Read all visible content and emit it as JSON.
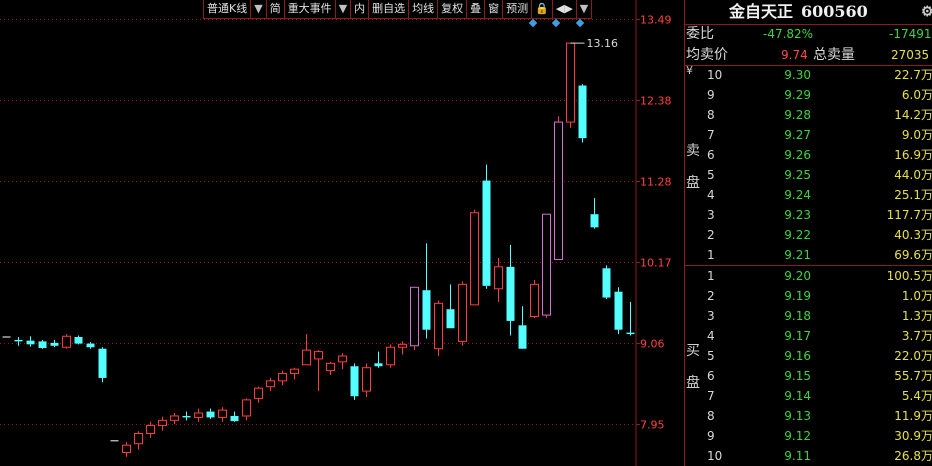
{
  "toolbar": {
    "items": [
      "普通K线",
      "▼",
      "简",
      "重大事件",
      "▼",
      "内",
      "删自选",
      "均线",
      "复权",
      "叠",
      "窗",
      "预测",
      "🔒",
      "◀▶",
      "▼"
    ]
  },
  "chart": {
    "annotation_high": "13.16",
    "axis_labels": [
      "13.49",
      "12.38",
      "11.28",
      "10.17",
      "9.06",
      "7.95"
    ],
    "colors": {
      "up": "#ff3c3c",
      "down": "#54ffff",
      "grid": "#8a1c1c",
      "axis_text": "#ff4040"
    }
  },
  "chart_data": {
    "type": "candlestick",
    "ylim": [
      7.6,
      13.6
    ],
    "ticks": [
      13.49,
      12.38,
      11.28,
      10.17,
      9.06,
      7.95
    ],
    "candles": [
      {
        "o": 9.14,
        "h": 9.14,
        "l": 9.14,
        "c": 9.14
      },
      {
        "o": 9.1,
        "h": 9.14,
        "l": 9.02,
        "c": 9.08
      },
      {
        "o": 9.09,
        "h": 9.15,
        "l": 9.01,
        "c": 9.04
      },
      {
        "o": 9.08,
        "h": 9.1,
        "l": 8.98,
        "c": 8.99
      },
      {
        "o": 9.06,
        "h": 9.1,
        "l": 9.0,
        "c": 9.02
      },
      {
        "o": 9.0,
        "h": 9.18,
        "l": 8.98,
        "c": 9.15
      },
      {
        "o": 9.14,
        "h": 9.16,
        "l": 9.04,
        "c": 9.05
      },
      {
        "o": 9.05,
        "h": 9.07,
        "l": 8.98,
        "c": 9.0
      },
      {
        "o": 8.98,
        "h": 9.0,
        "l": 8.52,
        "c": 8.58
      },
      {
        "o": 7.72,
        "h": 7.72,
        "l": 7.72,
        "c": 7.72
      },
      {
        "o": 7.56,
        "h": 7.7,
        "l": 7.5,
        "c": 7.66
      },
      {
        "o": 7.68,
        "h": 7.85,
        "l": 7.6,
        "c": 7.82
      },
      {
        "o": 7.82,
        "h": 7.98,
        "l": 7.76,
        "c": 7.93
      },
      {
        "o": 7.93,
        "h": 8.05,
        "l": 7.86,
        "c": 8.0
      },
      {
        "o": 8.0,
        "h": 8.1,
        "l": 7.95,
        "c": 8.06
      },
      {
        "o": 8.06,
        "h": 8.12,
        "l": 8.0,
        "c": 8.04
      },
      {
        "o": 8.04,
        "h": 8.16,
        "l": 7.98,
        "c": 8.1
      },
      {
        "o": 8.12,
        "h": 8.16,
        "l": 8.02,
        "c": 8.04
      },
      {
        "o": 8.04,
        "h": 8.18,
        "l": 7.98,
        "c": 8.14
      },
      {
        "o": 8.06,
        "h": 8.12,
        "l": 7.98,
        "c": 7.99
      },
      {
        "o": 8.06,
        "h": 8.3,
        "l": 8.0,
        "c": 8.28
      },
      {
        "o": 8.3,
        "h": 8.46,
        "l": 8.24,
        "c": 8.44
      },
      {
        "o": 8.46,
        "h": 8.58,
        "l": 8.4,
        "c": 8.54
      },
      {
        "o": 8.54,
        "h": 8.68,
        "l": 8.48,
        "c": 8.64
      },
      {
        "o": 8.64,
        "h": 8.72,
        "l": 8.56,
        "c": 8.7
      },
      {
        "o": 8.76,
        "h": 9.18,
        "l": 8.76,
        "c": 8.96
      },
      {
        "o": 8.84,
        "h": 8.96,
        "l": 8.4,
        "c": 8.94
      },
      {
        "o": 8.68,
        "h": 8.8,
        "l": 8.62,
        "c": 8.78
      },
      {
        "o": 8.8,
        "h": 8.92,
        "l": 8.7,
        "c": 8.88
      },
      {
        "o": 8.74,
        "h": 8.78,
        "l": 8.28,
        "c": 8.33
      },
      {
        "o": 8.4,
        "h": 8.78,
        "l": 8.32,
        "c": 8.72
      },
      {
        "o": 8.78,
        "h": 8.94,
        "l": 8.72,
        "c": 8.74
      },
      {
        "o": 8.76,
        "h": 9.04,
        "l": 8.72,
        "c": 9.0
      },
      {
        "o": 9.0,
        "h": 9.08,
        "l": 8.9,
        "c": 9.04
      },
      {
        "o": 9.02,
        "h": 9.82,
        "l": 8.96,
        "c": 9.82
      },
      {
        "o": 9.78,
        "h": 10.42,
        "l": 9.12,
        "c": 9.24
      },
      {
        "o": 8.98,
        "h": 9.64,
        "l": 8.88,
        "c": 9.6
      },
      {
        "o": 9.52,
        "h": 9.86,
        "l": 9.28,
        "c": 9.26
      },
      {
        "o": 9.08,
        "h": 9.9,
        "l": 9.02,
        "c": 9.86
      },
      {
        "o": 9.58,
        "h": 10.88,
        "l": 9.58,
        "c": 10.84
      },
      {
        "o": 11.28,
        "h": 11.5,
        "l": 9.8,
        "c": 9.84
      },
      {
        "o": 9.8,
        "h": 10.22,
        "l": 9.62,
        "c": 10.1
      },
      {
        "o": 10.1,
        "h": 10.4,
        "l": 9.16,
        "c": 9.36
      },
      {
        "o": 9.3,
        "h": 9.56,
        "l": 8.98,
        "c": 8.98
      },
      {
        "o": 9.42,
        "h": 9.92,
        "l": 9.4,
        "c": 9.86
      },
      {
        "o": 9.44,
        "h": 10.82,
        "l": 9.4,
        "c": 10.82
      },
      {
        "o": 10.2,
        "h": 12.16,
        "l": 10.2,
        "c": 12.08
      },
      {
        "o": 12.08,
        "h": 13.16,
        "l": 12.0,
        "c": 13.16
      },
      {
        "o": 12.58,
        "h": 12.6,
        "l": 11.8,
        "c": 11.86
      },
      {
        "o": 10.82,
        "h": 11.04,
        "l": 10.62,
        "c": 10.64
      },
      {
        "o": 10.08,
        "h": 10.12,
        "l": 9.66,
        "c": 9.68
      },
      {
        "o": 9.76,
        "h": 9.82,
        "l": 9.18,
        "c": 9.24
      },
      {
        "o": 9.2,
        "h": 9.62,
        "l": 9.16,
        "c": 9.18
      }
    ]
  },
  "book": {
    "stock_name": "金自天正",
    "stock_code": "600560",
    "gear_icon": "gear-icon",
    "weibi_label": "委比",
    "weibi_pct": "-47.82%",
    "weibi_diff": "-17491",
    "avg_label": "均卖价",
    "avg_price": "9.74",
    "total_label": "总卖量",
    "total_vol": "27035",
    "sell_side_label_1": "卖",
    "sell_side_label_2": "盘",
    "buy_side_label_1": "买",
    "buy_side_label_2": "盘",
    "currency": "¥",
    "sells": [
      {
        "lvl": "10",
        "price": "9.30",
        "vol": "22.7万"
      },
      {
        "lvl": "9",
        "price": "9.29",
        "vol": "6.0万"
      },
      {
        "lvl": "8",
        "price": "9.28",
        "vol": "14.2万"
      },
      {
        "lvl": "7",
        "price": "9.27",
        "vol": "9.0万"
      },
      {
        "lvl": "6",
        "price": "9.26",
        "vol": "16.9万"
      },
      {
        "lvl": "5",
        "price": "9.25",
        "vol": "44.0万"
      },
      {
        "lvl": "4",
        "price": "9.24",
        "vol": "25.1万"
      },
      {
        "lvl": "3",
        "price": "9.23",
        "vol": "117.7万"
      },
      {
        "lvl": "2",
        "price": "9.22",
        "vol": "40.3万"
      },
      {
        "lvl": "1",
        "price": "9.21",
        "vol": "69.6万"
      }
    ],
    "buys": [
      {
        "lvl": "1",
        "price": "9.20",
        "vol": "100.5万"
      },
      {
        "lvl": "2",
        "price": "9.19",
        "vol": "1.0万"
      },
      {
        "lvl": "3",
        "price": "9.18",
        "vol": "1.3万"
      },
      {
        "lvl": "4",
        "price": "9.17",
        "vol": "3.7万"
      },
      {
        "lvl": "5",
        "price": "9.16",
        "vol": "22.0万"
      },
      {
        "lvl": "6",
        "price": "9.15",
        "vol": "55.7万"
      },
      {
        "lvl": "7",
        "price": "9.14",
        "vol": "5.4万"
      },
      {
        "lvl": "8",
        "price": "9.13",
        "vol": "11.9万"
      },
      {
        "lvl": "9",
        "price": "9.12",
        "vol": "30.9万"
      },
      {
        "lvl": "10",
        "price": "9.11",
        "vol": "26.8万"
      }
    ]
  }
}
